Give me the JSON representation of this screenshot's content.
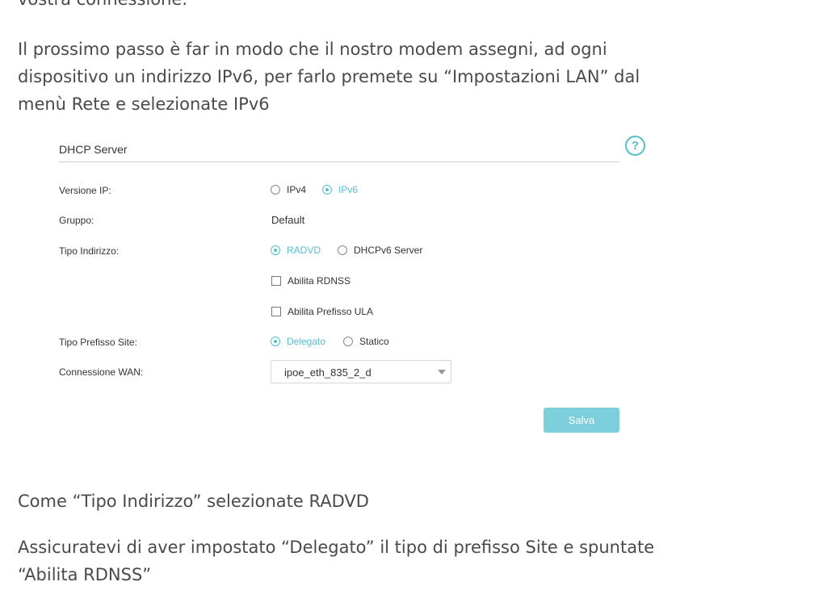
{
  "article": {
    "top_fragment": "vostra connessione.",
    "paragraph_1": "Il prossimo passo è far in modo che il nostro modem assegni, ad ogni\ndispositivo un indirizzo IPv6, per farlo premete su “Impostazioni LAN” dal\nmenù Rete e selezionate IPv6",
    "paragraph_2": "Come “Tipo Indirizzo” selezionate RADVD",
    "paragraph_3": "Assicuratevi di aver impostato “Delegato” il tipo di prefisso Site e spuntate\n“Abilita RDNSS”"
  },
  "panel": {
    "title": "DHCP Server",
    "help_icon": "question-circle-icon",
    "accent_color": "#55bfd0",
    "fields": {
      "ip_version": {
        "label": "Versione IP:",
        "options": [
          "IPv4",
          "IPv6"
        ],
        "selected": "IPv6"
      },
      "group": {
        "label": "Gruppo:",
        "value": "Default"
      },
      "address_type": {
        "label": "Tipo Indirizzo:",
        "options": [
          "RADVD",
          "DHCPv6 Server"
        ],
        "selected": "RADVD"
      },
      "enable_rdnss": {
        "label": "Abilita RDNSS",
        "checked": false
      },
      "enable_ula": {
        "label": "Abilita Prefisso ULA",
        "checked": false
      },
      "site_prefix_type": {
        "label": "Tipo Prefisso Site:",
        "options": [
          "Delegato",
          "Statico"
        ],
        "selected": "Delegato"
      },
      "wan_connection": {
        "label": "Connessione WAN:",
        "value": "ipoe_eth_835_2_d"
      }
    },
    "save_label": "Salva"
  }
}
